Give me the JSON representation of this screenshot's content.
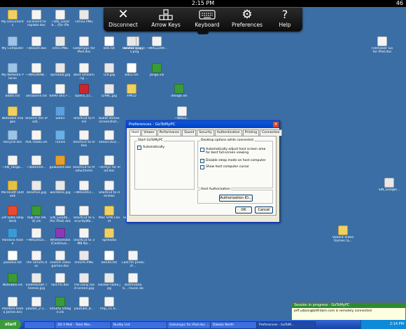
{
  "status_bar": {
    "time": "2:15 PM",
    "battery": "46"
  },
  "toolbar": {
    "disconnect": "Disconnect",
    "arrow_keys": "Arrow Keys",
    "keyboard": "Keyboard",
    "preferences": "Preferences",
    "help": "Help"
  },
  "desktop_icons": [
    {
      "label": "My Documents",
      "icon": "folder-icon",
      "color": "#f0d060"
    },
    {
      "label": "sixTevent template.doc",
      "icon": "doc-icon",
      "color": "#f4f4f4"
    },
    {
      "label": "~$fb_Goodb... (for iPad)...",
      "icon": "doc-icon",
      "color": "#f4f4f4"
    },
    {
      "label": "citrix2.PNG",
      "icon": "image-icon",
      "color": "#e8e8e8"
    },
    {
      "label": "Saved Images.png",
      "icon": "image-icon",
      "color": "#e8e8e8"
    },
    {
      "label": "My Computer",
      "icon": "computer-icon",
      "color": "#9cc3e8"
    },
    {
      "label": "~$ksure.doc",
      "icon": "doc-icon",
      "color": "#f4f4f4"
    },
    {
      "label": "citrix.PNG",
      "icon": "image-icon",
      "color": "#e8e8e8"
    },
    {
      "label": "Gotomypc for iPad.doc",
      "icon": "doc-icon",
      "color": "#f4f4f4"
    },
    {
      "label": "bds.txt",
      "icon": "text-icon",
      "color": "#ffffff"
    },
    {
      "label": "Benito2.jpg",
      "icon": "image-icon",
      "color": "#e8e8e8"
    },
    {
      "label": "~WRL2209...",
      "icon": "doc-icon",
      "color": "#f4f4f4"
    },
    {
      "label": "Filemaker Go for iPad.doc",
      "icon": "doc-icon",
      "color": "#f4f4f4"
    },
    {
      "label": "My Network Places",
      "icon": "network-icon",
      "color": "#9cc3e8"
    },
    {
      "label": "~WRL0698...",
      "icon": "doc-icon",
      "color": "#f4f4f4"
    },
    {
      "label": "spreadia.jpg",
      "icon": "image-icon",
      "color": "#e8e8e8"
    },
    {
      "label": "Best Streaming ...",
      "icon": "doc-icon",
      "color": "#f4f4f4"
    },
    {
      "label": "IZ9.jpg",
      "icon": "image-icon",
      "color": "#e8e8e8"
    },
    {
      "label": "bds2.txt",
      "icon": "text-icon",
      "color": "#ffffff"
    },
    {
      "label": "jango.xls",
      "icon": "excel-icon",
      "color": "#3a9a3a"
    },
    {
      "label": "bdbts.txt",
      "icon": "text-icon",
      "color": "#ffffff"
    },
    {
      "label": "amazonie.txt",
      "icon": "text-icon",
      "color": "#ffffff"
    },
    {
      "label": "6490-3657-...",
      "icon": "doc-icon",
      "color": "#f4f4f4"
    },
    {
      "label": "Opera_11...",
      "icon": "app-icon",
      "color": "#c8282c"
    },
    {
      "label": "IZ9KC.jpg",
      "icon": "image-icon",
      "color": "#e8e8e8"
    },
    {
      "label": "FMCD",
      "icon": "folder-icon",
      "color": "#f0d060"
    },
    {
      "label": "delage.xls",
      "icon": "excel-icon",
      "color": "#3a9a3a"
    },
    {
      "label": "Noteable images",
      "icon": "folder-icon",
      "color": "#f0d060"
    },
    {
      "label": "ShoFire (for iPad)...",
      "icon": "doc-icon",
      "color": "#f4f4f4"
    },
    {
      "label": "Safari",
      "icon": "app-icon",
      "color": "#5aa0e0"
    },
    {
      "label": "Shortcut to flmii",
      "icon": "shortcut-icon",
      "color": "#f4f4f4"
    },
    {
      "label": "bullet stones screenshot...",
      "icon": "image-icon",
      "color": "#e8e8e8"
    },
    {
      "label": "~WRL0...",
      "icon": "doc-icon",
      "color": "#f4f4f4"
    },
    {
      "label": "Recycle Bin",
      "icon": "recycle-bin-icon",
      "color": "#9cc3e8"
    },
    {
      "label": "AOL Radio.vls",
      "icon": "doc-icon",
      "color": "#f4f4f4"
    },
    {
      "label": "iTunes",
      "icon": "app-icon",
      "color": "#6ab0e8"
    },
    {
      "label": "Shortcut to Inbox",
      "icon": "shortcut-icon",
      "color": "#f4f4f4"
    },
    {
      "label": "seew1162(...",
      "icon": "doc-icon",
      "color": "#f4f4f4"
    },
    {
      "label": "~$N_Tango...",
      "icon": "doc-icon",
      "color": "#f4f4f4"
    },
    {
      "label": "~$DorenX...",
      "icon": "doc-icon",
      "color": "#f4f4f4"
    },
    {
      "label": "g2wizard.exe",
      "icon": "app-icon",
      "color": "#e6a030"
    },
    {
      "label": "Shortcut to Productmem",
      "icon": "shortcut-icon",
      "color": "#f4f4f4"
    },
    {
      "label": "~$rmyc for iPad.doc",
      "icon": "doc-icon",
      "color": "#f4f4f4"
    },
    {
      "label": "Microsoft Outlook",
      "icon": "outlook-icon",
      "color": "#e8c040"
    },
    {
      "label": "zenofive.jpg",
      "icon": "image-icon",
      "color": "#e8e8e8"
    },
    {
      "label": "wordlens.jpg",
      "icon": "image-icon",
      "color": "#e8e8e8"
    },
    {
      "label": "~WRL0001...",
      "icon": "doc-icon",
      "color": "#f4f4f4"
    },
    {
      "label": "Shortcut to Reviews",
      "icon": "shortcut-icon",
      "color": "#f4f4f4"
    },
    {
      "label": "ZIP Data Helpdesk",
      "icon": "app-icon",
      "color": "#e84c30"
    },
    {
      "label": "Yelp (for iPad).xls",
      "icon": "excel-icon",
      "color": "#3a9a3a"
    },
    {
      "label": "SIN_Goodb... (for iPad).doc",
      "icon": "doc-icon",
      "color": "#f4f4f4"
    },
    {
      "label": "Shortcut to SecurityWa...",
      "icon": "shortcut-icon",
      "color": "#f4f4f4"
    },
    {
      "label": "Mac VPN Client",
      "icon": "folder-icon",
      "color": "#f0d060"
    },
    {
      "label": "Shortcut to IDL",
      "icon": "shortcut-icon",
      "color": "#f4f4f4"
    },
    {
      "label": "Pandora Radio",
      "icon": "app-icon",
      "color": "#3a9ad8"
    },
    {
      "label": "~WRL0025...",
      "icon": "doc-icon",
      "color": "#f4f4f4"
    },
    {
      "label": "WhiteSmoke (Continue...",
      "icon": "app-icon",
      "color": "#8a3ab8"
    },
    {
      "label": "Shortcut to 3MB No...",
      "icon": "shortcut-icon",
      "color": "#f4f4f4"
    },
    {
      "label": "Spreadia",
      "icon": "folder-icon",
      "color": "#f0d060"
    },
    {
      "label": "paladus.txt",
      "icon": "text-icon",
      "color": "#ffffff"
    },
    {
      "label": "The Smurfs.doc",
      "icon": "doc-icon",
      "color": "#f4f4f4"
    },
    {
      "label": "violent video games.doc",
      "icon": "doc-icon",
      "color": "#f4f4f4"
    },
    {
      "label": "smurfs.PNG",
      "icon": "image-icon",
      "color": "#e8e8e8"
    },
    {
      "label": "benito.txt",
      "icon": "text-icon",
      "color": "#ffffff"
    },
    {
      "label": "Last.fm product...",
      "icon": "doc-icon",
      "color": "#f4f4f4"
    },
    {
      "label": "Noteable.xls",
      "icon": "excel-icon",
      "color": "#3a9a3a"
    },
    {
      "label": "SlideRocket Themes.jpg",
      "icon": "image-icon",
      "color": "#e8e8e8"
    },
    {
      "label": "last.fm.doc",
      "icon": "doc-icon",
      "color": "#f4f4f4"
    },
    {
      "label": "The Daily load screen.jpg",
      "icon": "image-icon",
      "color": "#e8e8e8"
    },
    {
      "label": "slacker-radio.jpg",
      "icon": "image-icon",
      "color": "#e8e8e8"
    },
    {
      "label": "lastfmdatab... music.doc",
      "icon": "doc-icon",
      "color": "#f4f4f4"
    },
    {
      "label": "Pandora Radio James.brow...",
      "icon": "doc-icon",
      "color": "#f4f4f4"
    },
    {
      "label": "yoodar_2-1...",
      "icon": "doc-icon",
      "color": "#f4f4f4"
    },
    {
      "label": "Smurfy Village.xls",
      "icon": "excel-icon",
      "color": "#3a9a3a"
    },
    {
      "label": "youtube_b...",
      "icon": "doc-icon",
      "color": "#f4f4f4"
    },
    {
      "label": "fmp_11.0...",
      "icon": "app-icon",
      "color": "#f4f4f4"
    },
    {
      "label": "Violent Video Games (a...",
      "icon": "folder-icon",
      "color": "#f0d060"
    },
    {
      "label": "SIN_Google...",
      "icon": "image-icon",
      "color": "#e8e8e8"
    }
  ],
  "preferences_dialog": {
    "title": "Preferences - GoToMyPC",
    "tabs": [
      "Host",
      "Viewer",
      "Performance",
      "Sound",
      "Security",
      "Authentication",
      "Printing",
      "Connection"
    ],
    "start_group": "Start GoToMyPC",
    "auto_start": "Automatically",
    "desktop_group": "Desktop options while connected",
    "opt1": "Automatically adjust host screen area for best full-screen viewing",
    "opt2": "Disable sleep mode on host computer",
    "opt3": "Show host computer cursor",
    "host_auth_group": "Host Authorization",
    "auth_button": "Authorization ID...",
    "ok": "OK",
    "cancel": "Cancel"
  },
  "notification": {
    "title": "Session in progress - GoToMyPC",
    "message": "jeff.udzon@bitfrdom.com is remotely connected"
  },
  "taskbar": {
    "start": "start",
    "items": [
      "",
      "2D-3 Mail - Total Wor...",
      "Buddy List",
      "Gotomypc for iPad.doc ...",
      "Dakota North",
      "Preferences - GoToM..."
    ],
    "clock": "2:14 PM"
  }
}
